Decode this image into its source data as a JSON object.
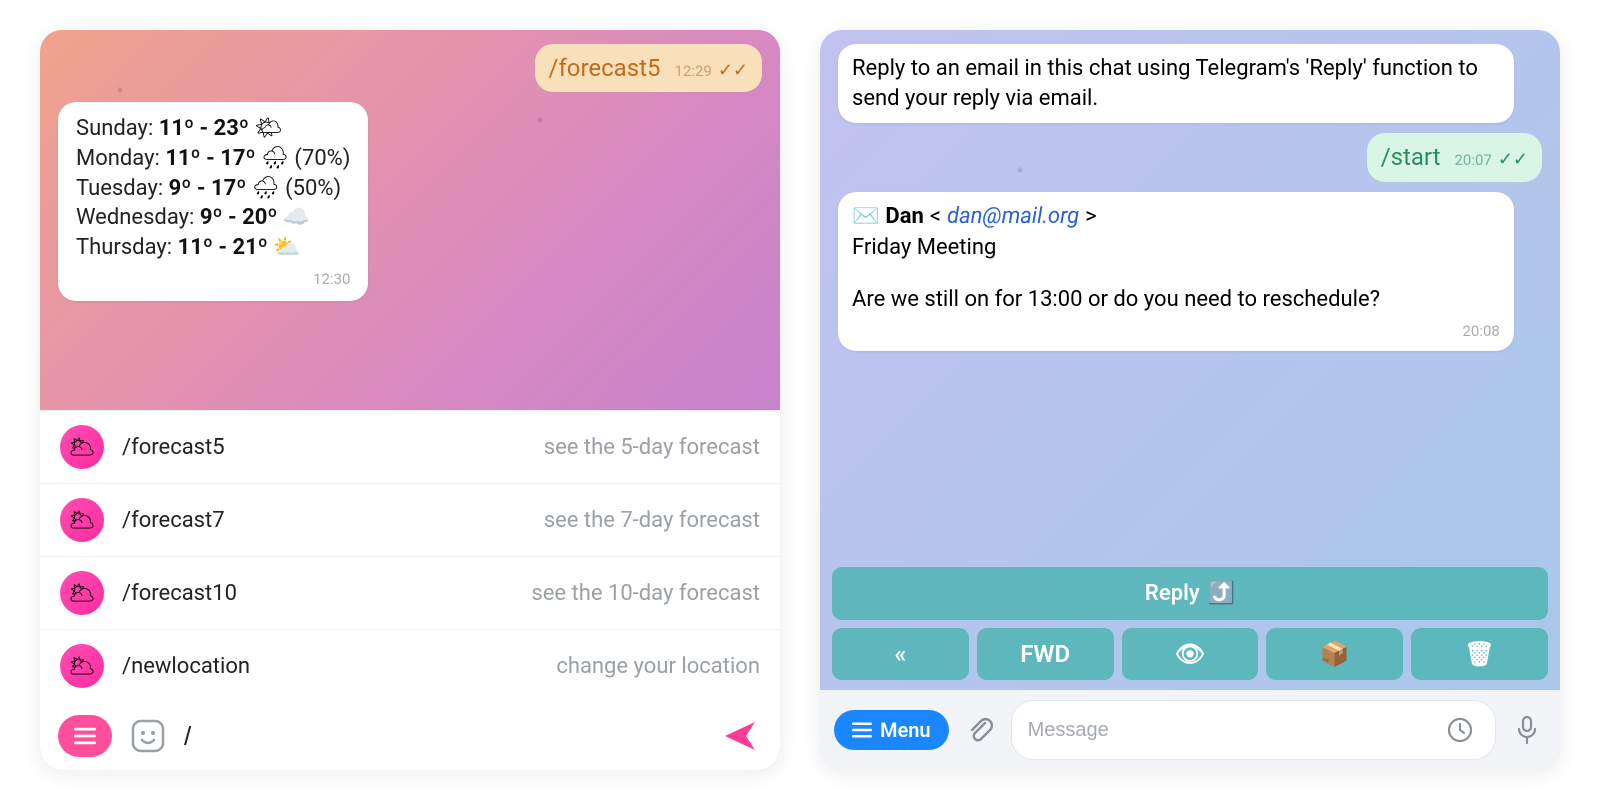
{
  "left": {
    "outgoing": {
      "command": "/forecast5",
      "time": "12:29",
      "ticks": "✓✓"
    },
    "forecast": {
      "rows": [
        {
          "day": "Sunday:",
          "temp": "11º - 23º",
          "icon": "🌤",
          "extra": ""
        },
        {
          "day": "Monday:",
          "temp": "11º - 17º",
          "icon": "🌧",
          "extra": "(70%)"
        },
        {
          "day": "Tuesday:",
          "temp": "9º - 17º",
          "icon": "🌧",
          "extra": "(50%)"
        },
        {
          "day": "Wednesday:",
          "temp": "9º - 20º",
          "icon": "☁️",
          "extra": ""
        },
        {
          "day": "Thursday:",
          "temp": "11º - 21º",
          "icon": "⛅",
          "extra": ""
        }
      ],
      "time": "12:30"
    },
    "commands": [
      {
        "cmd": "/forecast5",
        "desc": "see the 5-day forecast",
        "avatar": "🌥"
      },
      {
        "cmd": "/forecast7",
        "desc": "see the 7-day forecast",
        "avatar": "🌥"
      },
      {
        "cmd": "/forecast10",
        "desc": "see the 10-day forecast",
        "avatar": "🌥"
      },
      {
        "cmd": "/newlocation",
        "desc": "change your location",
        "avatar": "🌥"
      }
    ],
    "input_value": "/"
  },
  "right": {
    "intro": "Reply to an email in this chat using Telegram's 'Reply' function to send your reply via email.",
    "outgoing": {
      "command": "/start",
      "time": "20:07",
      "ticks": "✓✓"
    },
    "email": {
      "icon": "✉️",
      "from_name": "Dan",
      "from_addr_open": "<",
      "from_addr": "dan@mail.org",
      "from_addr_close": ">",
      "subject": "Friday Meeting",
      "body": "Are we still on for 13:00 or do you need to reschedule?",
      "time": "20:08"
    },
    "keyboard": {
      "reply_label": "Reply",
      "reply_icon": "⤴️",
      "row2": [
        {
          "label": "«"
        },
        {
          "label": "FWD"
        },
        {
          "label": "👁"
        },
        {
          "label": "📦"
        },
        {
          "label": "🗑"
        }
      ]
    },
    "menu_label": "Menu",
    "message_placeholder": "Message"
  }
}
